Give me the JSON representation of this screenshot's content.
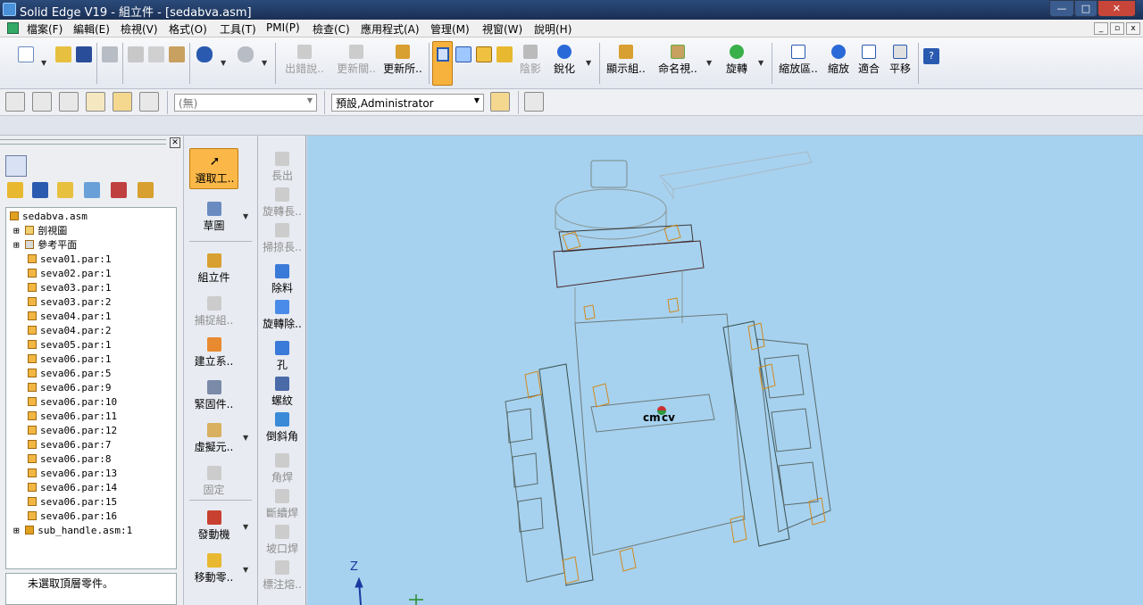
{
  "window": {
    "title": "Solid Edge V19 - 組立件 - [sedabva.asm]",
    "controls": {
      "minimize": "—",
      "maximize": "□",
      "close": "✕"
    }
  },
  "menu": {
    "items": [
      "檔案(F)",
      "編輯(E)",
      "檢視(V)",
      "格式(O)",
      "工具(T)",
      "PMI(P)",
      "檢查(C)",
      "應用程式(A)",
      "管理(M)",
      "視窗(W)",
      "說明(H)"
    ]
  },
  "toolbar1": {
    "labels": {
      "catch_error": "出錯說..",
      "update_link": "更新關..",
      "update_all": "更新所..",
      "shadow": "陰影",
      "sharpen": "銳化",
      "show_group": "顯示組..",
      "named_view": "命名視..",
      "rotate": "旋轉",
      "zoom_area": "縮放區..",
      "zoom": "縮放",
      "fit": "適合",
      "pan": "平移"
    }
  },
  "toolbar2": {
    "layer_combo": "(無)",
    "user_combo": "預設,Administrator"
  },
  "tree": {
    "root": "sedabva.asm",
    "nodes": [
      "剖視圖",
      "參考平面",
      "seva01.par:1",
      "seva02.par:1",
      "seva03.par:1",
      "seva03.par:2",
      "seva04.par:1",
      "seva04.par:2",
      "seva05.par:1",
      "seva06.par:1",
      "seva06.par:5",
      "seva06.par:9",
      "seva06.par:10",
      "seva06.par:11",
      "seva06.par:12",
      "seva06.par:7",
      "seva06.par:8",
      "seva06.par:13",
      "seva06.par:14",
      "seva06.par:15",
      "seva06.par:16",
      "sub_handle.asm:1"
    ]
  },
  "status": {
    "message": "未選取頂層零件。"
  },
  "command_bar": {
    "left": [
      "選取工..",
      "草圖",
      "組立件",
      "捕捉組..",
      "建立系..",
      "緊固件..",
      "虛擬元..",
      "固定",
      "發動機",
      "移動零.."
    ],
    "right": [
      "長出",
      "旋轉長..",
      "掃掠長..",
      "除料",
      "旋轉除..",
      "孔",
      "螺紋",
      "倒斜角",
      "角焊",
      "斷續焊",
      "坡口焊",
      "標注熔.."
    ]
  },
  "viewport": {
    "bg_color": "#a6d2ef",
    "cm_label": "cm",
    "cv_label": "cv",
    "axis_label": "Z"
  }
}
